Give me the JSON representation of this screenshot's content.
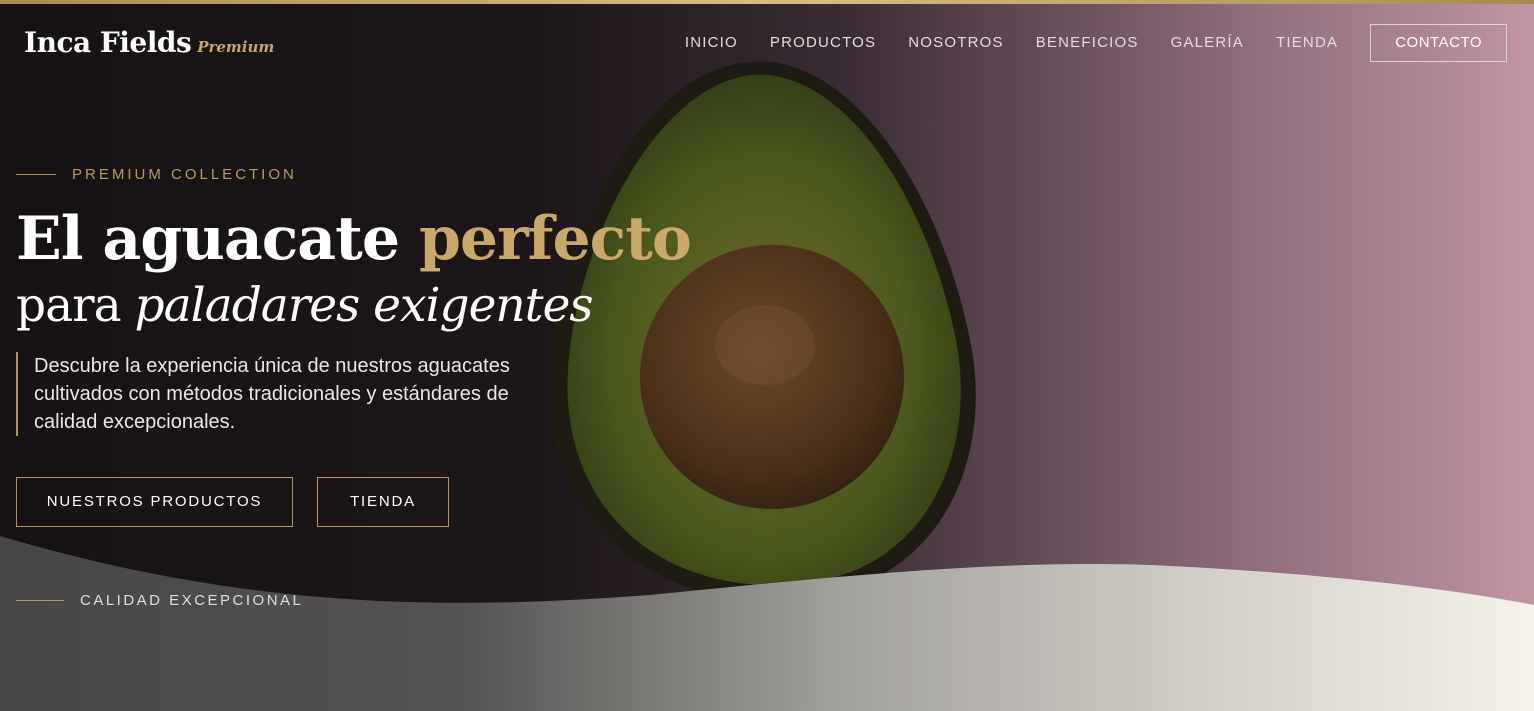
{
  "brand": {
    "name": "Inca Fields",
    "tag": "Premium"
  },
  "nav": {
    "items": [
      "INICIO",
      "PRODUCTOS",
      "NOSOTROS",
      "BENEFICIOS",
      "GALERÍA",
      "TIENDA"
    ],
    "contact": "CONTACTO"
  },
  "hero": {
    "eyebrow": "PREMIUM COLLECTION",
    "headline_a": "El aguacate ",
    "headline_b": "perfecto",
    "subhead_a": "para ",
    "subhead_b": "paladares exigentes",
    "description": "Descubre la experiencia única de nuestros aguacates cultivados con métodos tradicionales y estándares de calidad excepcionales.",
    "btn_products": "NUESTROS PRODUCTOS",
    "btn_store": "TIENDA"
  },
  "quality": {
    "label": "CALIDAD EXCEPCIONAL"
  },
  "colors": {
    "accent": "#c9a96a",
    "dark": "#1a1517",
    "rose": "#c096a2"
  }
}
